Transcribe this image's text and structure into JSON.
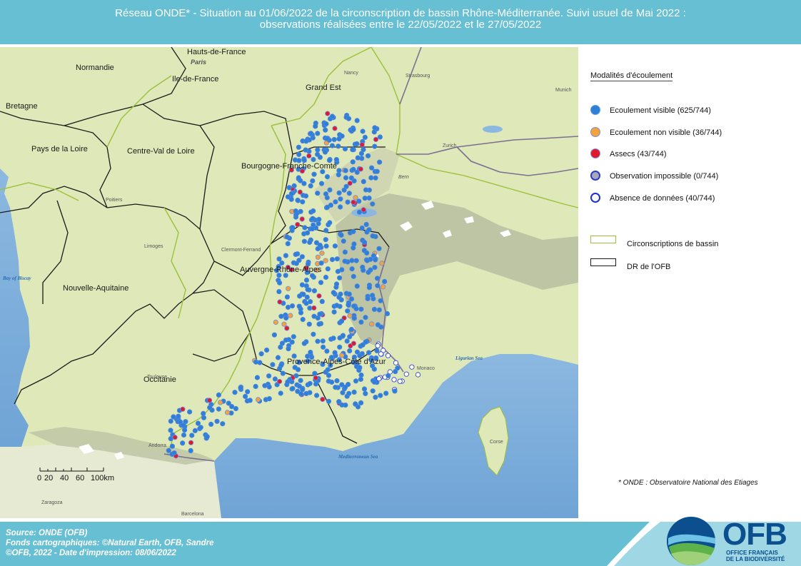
{
  "header": {
    "line1": "Réseau ONDE* - Situation au 01/06/2022 de la circonscription de bassin Rhône-Méditerranée. Suivi usuel de Mai 2022 :",
    "line2": "observations réalisées entre le 22/05/2022 et le 27/05/2022"
  },
  "map": {
    "regions": [
      {
        "id": "hauts-de-france",
        "label": "Hauts-de-France"
      },
      {
        "id": "normandie",
        "label": "Normandie"
      },
      {
        "id": "ile-de-france",
        "label": "Ile-de-France"
      },
      {
        "id": "bretagne",
        "label": "Bretagne"
      },
      {
        "id": "grand-est",
        "label": "Grand Est"
      },
      {
        "id": "pays-de-la-loire",
        "label": "Pays de la Loire"
      },
      {
        "id": "centre-val-de-loire",
        "label": "Centre-Val de Loire"
      },
      {
        "id": "bourgogne-franche-comte",
        "label": "Bourgogne-Franche-Comté"
      },
      {
        "id": "auvergne-rhone-alpes",
        "label": "Auvergne-Rhône-Alpes"
      },
      {
        "id": "nouvelle-aquitaine",
        "label": "Nouvelle-Aquitaine"
      },
      {
        "id": "occitanie",
        "label": "Occitanie"
      },
      {
        "id": "provence-alpes-cote-d-azur",
        "label": "Provence-Alpes-Côte d'Azur"
      },
      {
        "id": "corse",
        "label": "Corse"
      }
    ],
    "places": [
      {
        "id": "paris",
        "label": "Paris"
      },
      {
        "id": "nancy",
        "label": "Nancy"
      },
      {
        "id": "strasbourg",
        "label": "Strasbourg"
      },
      {
        "id": "munich",
        "label": "Munich"
      },
      {
        "id": "zurich",
        "label": "Zurich"
      },
      {
        "id": "bern",
        "label": "Bern"
      },
      {
        "id": "poitiers",
        "label": "Poitiers"
      },
      {
        "id": "limoges",
        "label": "Limoges"
      },
      {
        "id": "clermont-ferrand",
        "label": "Clermont-Ferrand"
      },
      {
        "id": "toulouse",
        "label": "Toulouse"
      },
      {
        "id": "monaco",
        "label": "Monaco"
      },
      {
        "id": "andorra",
        "label": "Andorra"
      },
      {
        "id": "zaragoza",
        "label": "Zaragoza"
      },
      {
        "id": "barcelona",
        "label": "Barcelona"
      }
    ],
    "seas": [
      {
        "id": "bay-of-biscay",
        "label": "Bay of Biscay"
      },
      {
        "id": "ligurian-sea",
        "label": "Ligurian Sea"
      },
      {
        "id": "mediterranean-sea",
        "label": "Mediterranean Sea"
      }
    ],
    "scale": {
      "labels": [
        "0",
        "20",
        "40",
        "60",
        "100km"
      ]
    }
  },
  "legend": {
    "title": "Modalités d'écoulement",
    "items": [
      {
        "label": "Ecoulement visible (625/744)",
        "color": "#2f7fd6"
      },
      {
        "label": "Ecoulement non visible (36/744)",
        "color": "#f4a23c"
      },
      {
        "label": "Assecs (43/744)",
        "color": "#e01a2c"
      },
      {
        "label": "Observation impossible (0/744)",
        "color": "#a8a8b8"
      },
      {
        "label": "Absence de données (40/744)",
        "color": "#ffffff"
      }
    ],
    "boundaries": [
      {
        "label": "Circonscriptions de bassin",
        "color": "#9bc03a"
      },
      {
        "label": "DR de l'OFB",
        "color": "#1a1a1a"
      }
    ],
    "footnote": "* ONDE : Observatoire National des Etiages"
  },
  "footer": {
    "source": "Source: ONDE (OFB)",
    "fonds": "Fonds cartographiques: ©Natural Earth, OFB, Sandre",
    "copyright": "©OFB, 2022 - Date d'impression: 08/06/2022"
  },
  "logo": {
    "name": "OFB",
    "subtitle1": "OFFICE FRANÇAIS",
    "subtitle2": "DE LA BIODIVERSITÉ"
  }
}
